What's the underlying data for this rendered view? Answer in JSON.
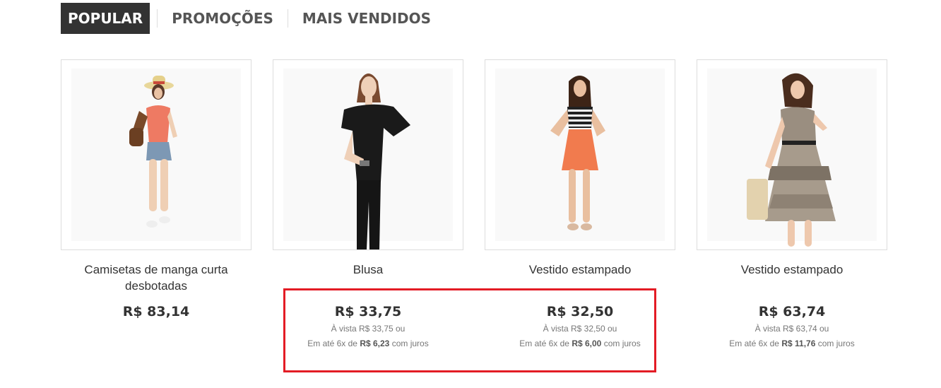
{
  "tabs": [
    {
      "label": "POPULAR",
      "active": true
    },
    {
      "label": "PROMOÇÕES",
      "active": false
    },
    {
      "label": "MAIS VENDIDOS",
      "active": false
    }
  ],
  "products": [
    {
      "name": "Camisetas de manga curta desbotadas",
      "price": "R$ 83,14",
      "cash": "",
      "installment_prefix": "",
      "installment_value": "",
      "installment_suffix": "",
      "image": "woman-hat-orange-top-shorts"
    },
    {
      "name": "Blusa",
      "price": "R$ 33,75",
      "cash": "À vista R$ 33,75 ou",
      "installment_prefix": "Em até 6x de",
      "installment_value": "R$ 6,23",
      "installment_suffix": "com juros",
      "image": "woman-black-blouse"
    },
    {
      "name": "Vestido estampado",
      "price": "R$ 32,50",
      "cash": "À vista R$ 32,50 ou",
      "installment_prefix": "Em até 6x de",
      "installment_value": "R$ 6,00",
      "installment_suffix": "com juros",
      "image": "woman-striped-top-orange-skirt"
    },
    {
      "name": "Vestido estampado",
      "price": "R$ 63,74",
      "cash": "À vista R$ 63,74 ou",
      "installment_prefix": "Em até 6x de",
      "installment_value": "R$ 11,76",
      "installment_suffix": "com juros",
      "image": "woman-printed-dress"
    }
  ],
  "colors": {
    "active_tab_bg": "#333333",
    "highlight_border": "#e31c25",
    "text": "#333333",
    "muted": "#777777"
  }
}
